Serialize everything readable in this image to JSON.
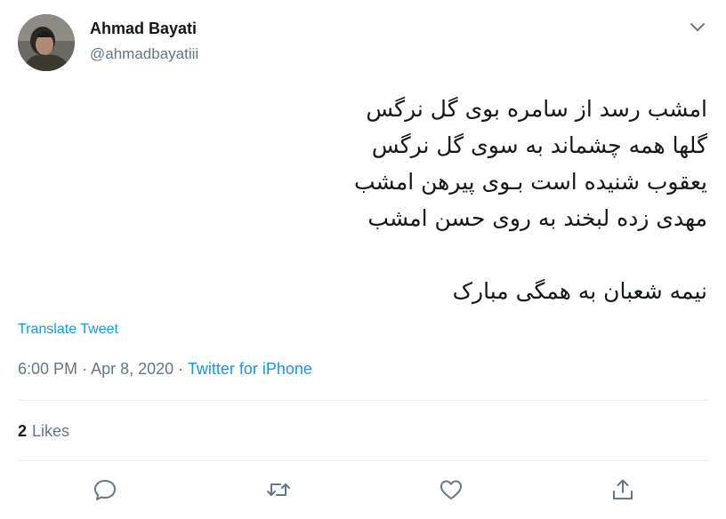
{
  "author": {
    "name": "Ahmad Bayati",
    "handle": "@ahmadbayatiii"
  },
  "tweet": {
    "text": "امشب رسد از سامره بوی گل نرگس\nگلها همه چشماند به سوی گل نرگس\nیعقوب شنیده است بـوی پیرهن امشب\nمهدی زده لبخند به روی حسن امشب\n\nنیمه شعبان به همگی مبارک",
    "translate_label": "Translate Tweet"
  },
  "meta": {
    "time": "6:00 PM",
    "date": "Apr 8, 2020",
    "source": "Twitter for iPhone"
  },
  "stats": {
    "likes_count": "2",
    "likes_label": "Likes"
  },
  "actions": {
    "icons": [
      "reply-icon",
      "retweet-icon",
      "like-icon",
      "share-icon"
    ]
  },
  "colors": {
    "accent": "#1b95e0",
    "secondary_text": "#657786",
    "divider": "#e6ecf0"
  }
}
